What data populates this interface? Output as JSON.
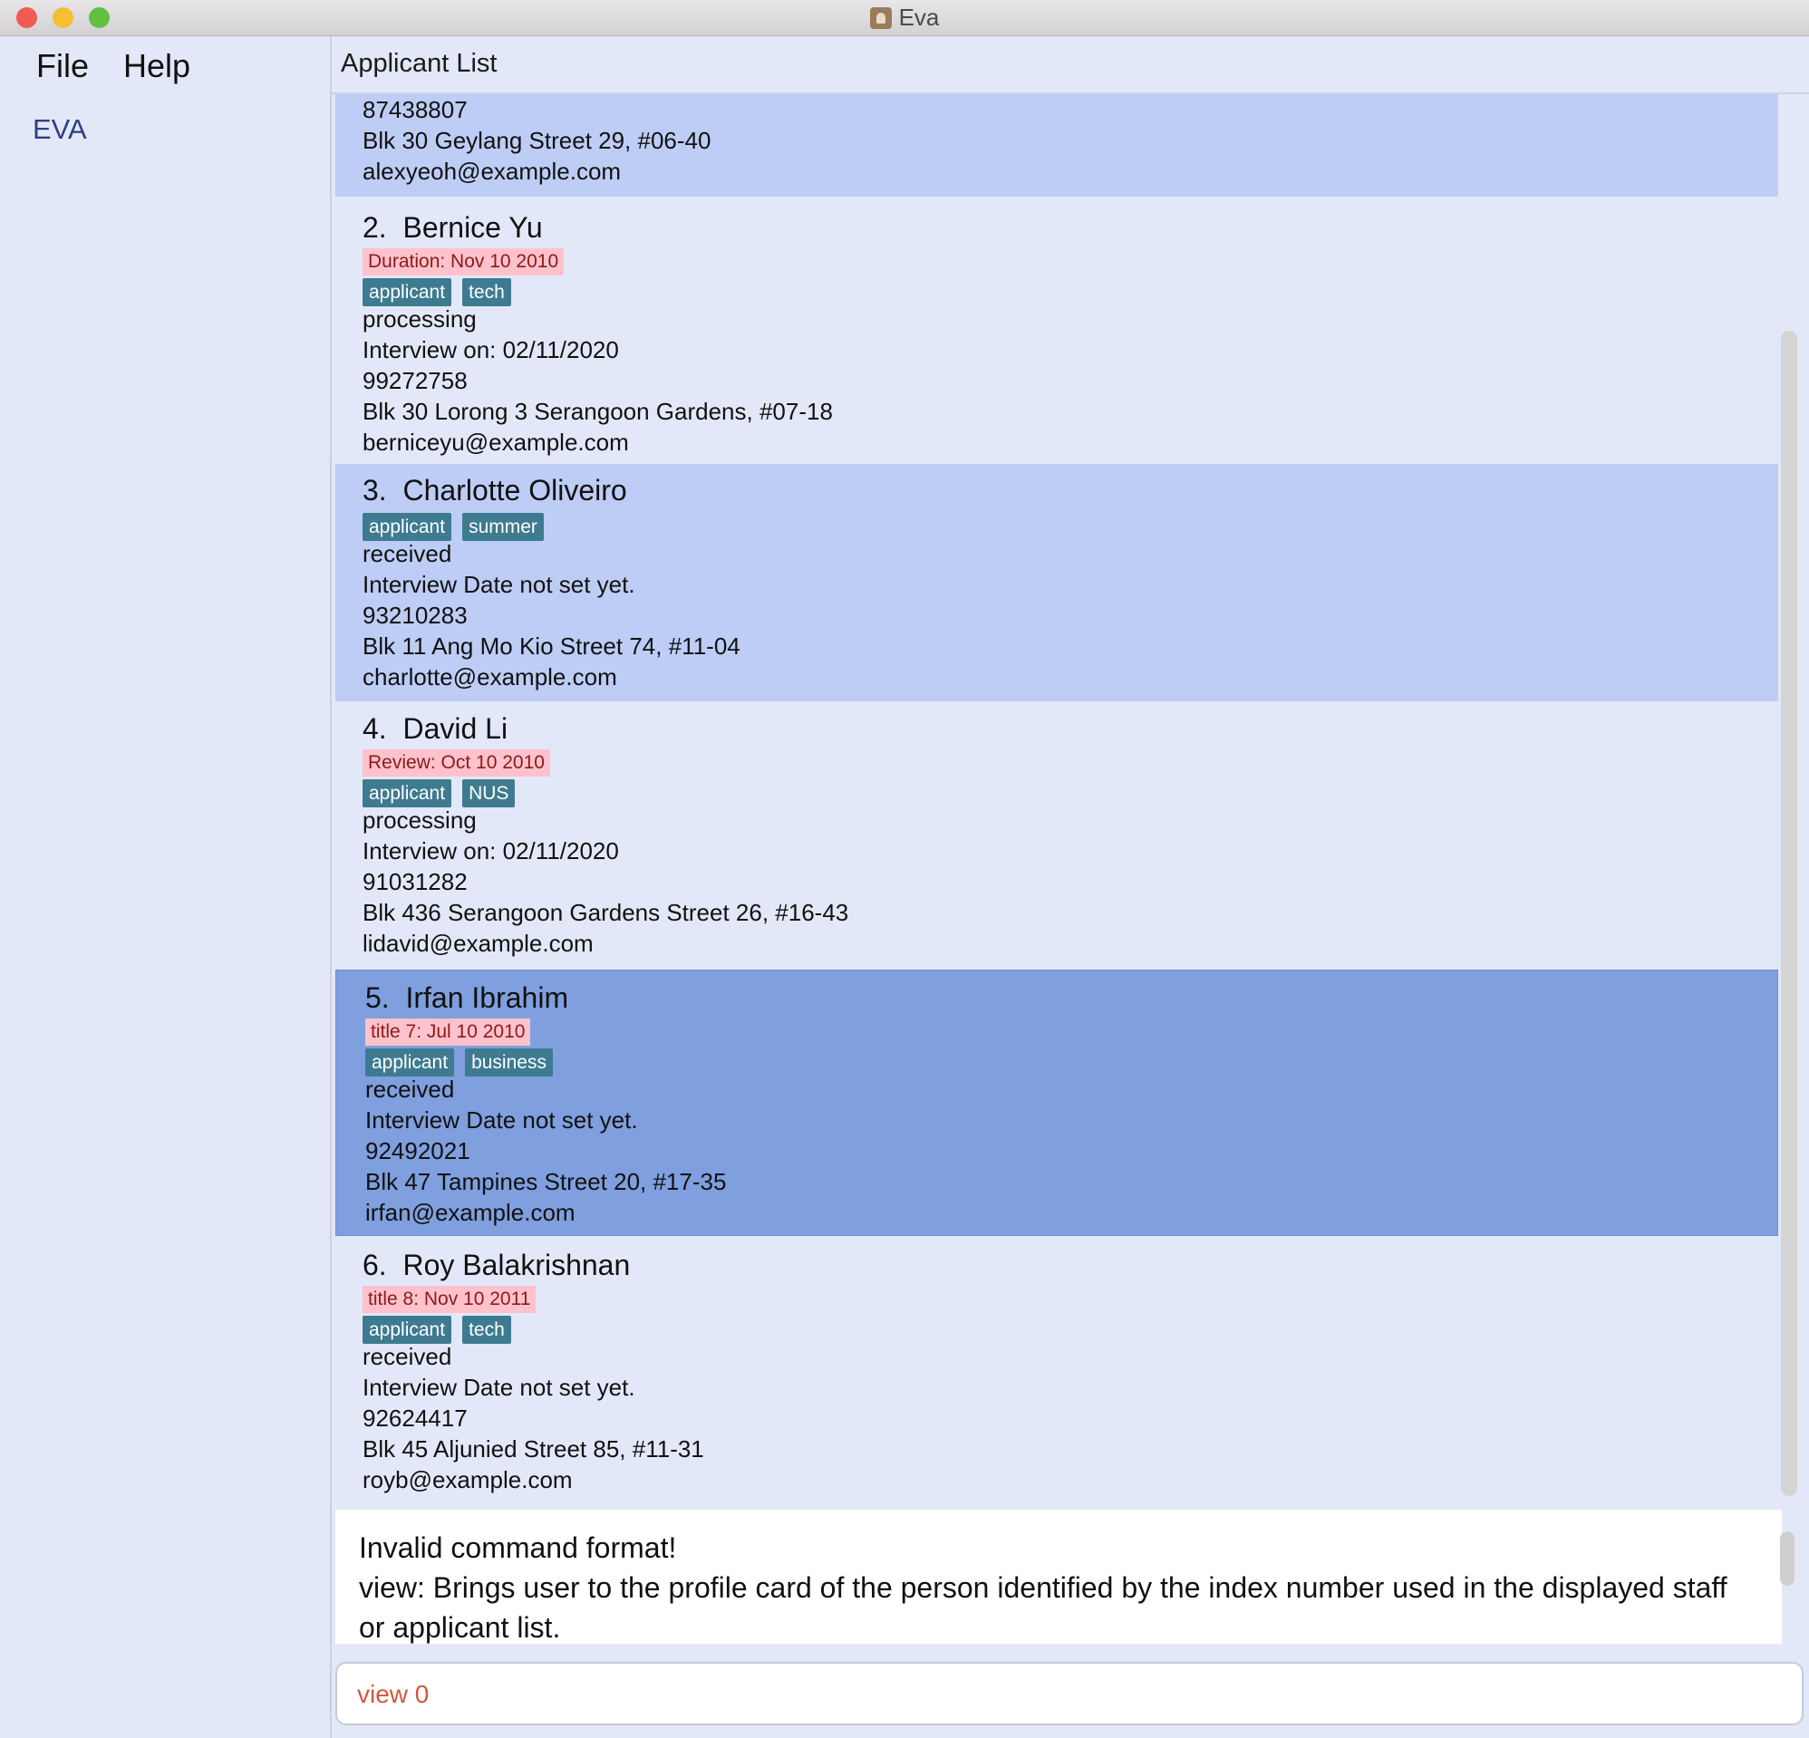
{
  "window": {
    "title": "Eva"
  },
  "menu": {
    "file": "File",
    "help": "Help"
  },
  "sidebar": {
    "brand": "EVA"
  },
  "list": {
    "header": "Applicant List"
  },
  "partial_card": {
    "phone": "87438807",
    "address": "Blk 30 Geylang Street 29, #06-40",
    "email": "alexyeoh@example.com"
  },
  "applicants": [
    {
      "index": "2.",
      "name": "Bernice Yu",
      "event": "Duration: Nov 10 2010",
      "tags": [
        "applicant",
        "tech"
      ],
      "status": "processing",
      "interview": "Interview on: 02/11/2020",
      "phone": "99272758",
      "address": "Blk 30 Lorong 3 Serangoon Gardens, #07-18",
      "email": "berniceyu@example.com"
    },
    {
      "index": "3.",
      "name": "Charlotte Oliveiro",
      "event": "",
      "tags": [
        "applicant",
        "summer"
      ],
      "status": "received",
      "interview": "Interview Date not set yet.",
      "phone": "93210283",
      "address": "Blk 11 Ang Mo Kio Street 74, #11-04",
      "email": "charlotte@example.com"
    },
    {
      "index": "4.",
      "name": "David Li",
      "event": "Review: Oct 10 2010",
      "tags": [
        "applicant",
        "NUS"
      ],
      "status": "processing",
      "interview": "Interview on: 02/11/2020",
      "phone": "91031282",
      "address": "Blk 436 Serangoon Gardens Street 26, #16-43",
      "email": "lidavid@example.com"
    },
    {
      "index": "5.",
      "name": "Irfan Ibrahim",
      "event": "title 7: Jul 10 2010",
      "tags": [
        "applicant",
        "business"
      ],
      "status": "received",
      "interview": "Interview Date not set yet.",
      "phone": "92492021",
      "address": "Blk 47 Tampines Street 20, #17-35",
      "email": "irfan@example.com"
    },
    {
      "index": "6.",
      "name": "Roy Balakrishnan",
      "event": "title 8: Nov 10 2011",
      "tags": [
        "applicant",
        "tech"
      ],
      "status": "received",
      "interview": "Interview Date not set yet.",
      "phone": "92624417",
      "address": "Blk 45 Aljunied Street 85, #11-31",
      "email": "royb@example.com"
    }
  ],
  "result": {
    "line1": "Invalid command format!",
    "line2": "view: Brings user to the profile card of the person identified by the index number used in the displayed staff or applicant list."
  },
  "command": {
    "value": "view 0"
  },
  "colors": {
    "selected": "#7f9fde",
    "alt": "#bdcdf5",
    "normal": "#e3e8f8",
    "tag": "#3e7b91",
    "event_pill": "#ffc2cc"
  }
}
